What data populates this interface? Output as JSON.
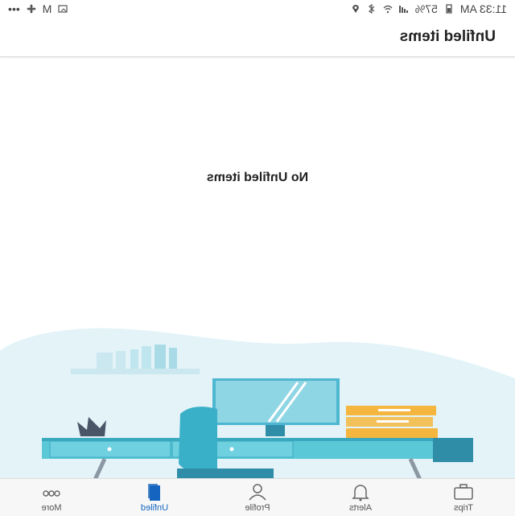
{
  "status_bar": {
    "time": "11:33 AM",
    "battery": "57%",
    "dots": "•••",
    "icons": [
      "location-icon",
      "bluetooth-icon",
      "wifi-icon",
      "signal-icon",
      "battery-icon",
      "fan-icon",
      "gmail-icon",
      "image-icon"
    ]
  },
  "header": {
    "title": "Unfiled items"
  },
  "main": {
    "empty_message": "No Unfiled items"
  },
  "bottom_nav": {
    "items": [
      {
        "label": "Trips",
        "icon": "suitcase-icon"
      },
      {
        "label": "Alerts",
        "icon": "bell-icon"
      },
      {
        "label": "Profile",
        "icon": "person-icon"
      },
      {
        "label": "Unfiled",
        "icon": "folder-icon",
        "active": true
      },
      {
        "label": "More",
        "icon": "more-dots-icon"
      }
    ]
  },
  "colors": {
    "accent": "#1565c0",
    "illustration_bg": "#e3f3f8",
    "desk": "#5bc8d8",
    "chair": "#3ab0c8",
    "files": "#f4b63e"
  }
}
